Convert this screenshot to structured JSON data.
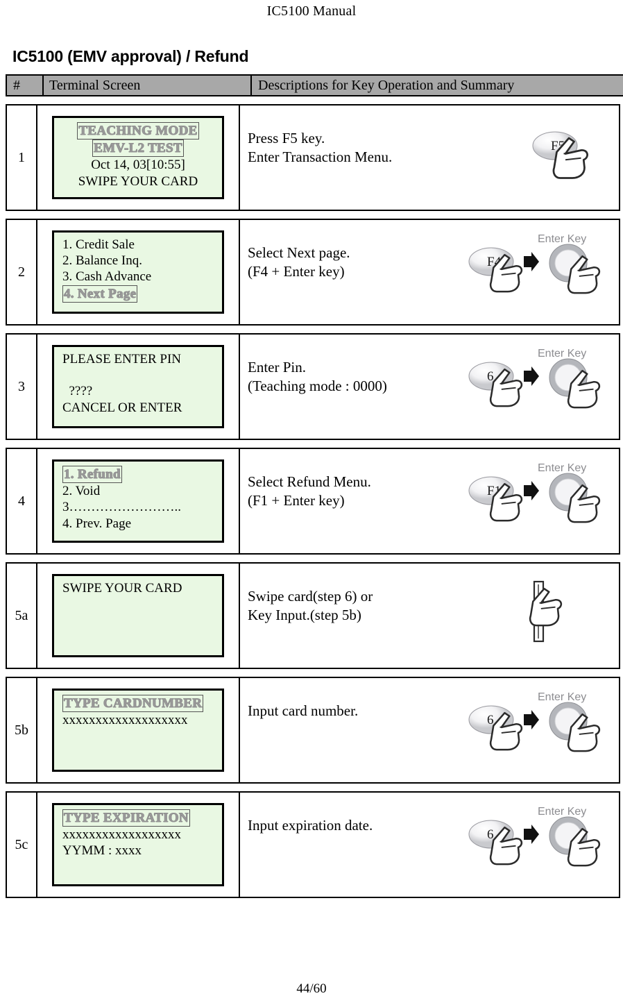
{
  "document": {
    "running_head": "IC5100 Manual",
    "section_title": "IC5100 (EMV approval) / Refund",
    "page_number": "44/60"
  },
  "table": {
    "headers": {
      "number": "#",
      "terminal_screen": "Terminal Screen",
      "description": "Descriptions for Key Operation and Summary"
    },
    "rows": [
      {
        "step": "1",
        "screen_lines": [
          {
            "text": "TEACHING MODE",
            "style": "outline",
            "align": "center"
          },
          {
            "text": "EMV-L2 TEST",
            "style": "outline",
            "align": "center"
          },
          {
            "text": "Oct 14, 03[10:55]",
            "style": "plain",
            "align": "center"
          },
          {
            "text": "SWIPE YOUR CARD",
            "style": "plain",
            "align": "center"
          }
        ],
        "description": "Press F5 key.\nEnter Transaction Menu.",
        "key_art": {
          "type": "single",
          "key_label": "F5",
          "enter_label": ""
        }
      },
      {
        "step": "2",
        "screen_lines": [
          {
            "text": "1. Credit Sale",
            "style": "plain",
            "align": "left"
          },
          {
            "text": "2. Balance Inq.",
            "style": "plain",
            "align": "left"
          },
          {
            "text": "3. Cash Advance",
            "style": "plain",
            "align": "left"
          },
          {
            "text": "4. Next Page",
            "style": "outline",
            "align": "left"
          }
        ],
        "description": "Select Next page.\n(F4 + Enter key)",
        "key_art": {
          "type": "combo",
          "key_label": "F4",
          "enter_label": "Enter Key"
        }
      },
      {
        "step": "3",
        "screen_lines": [
          {
            "text": "PLEASE ENTER PIN",
            "style": "plain",
            "align": "left"
          },
          {
            "text": " ",
            "style": "blank",
            "align": "left"
          },
          {
            "text": "  ????",
            "style": "plain",
            "align": "left"
          },
          {
            "text": "CANCEL OR ENTER",
            "style": "plain",
            "align": "left"
          }
        ],
        "description": "Enter Pin.\n(Teaching mode : 0000)",
        "key_art": {
          "type": "combo",
          "key_label": "6",
          "enter_label": "Enter Key"
        }
      },
      {
        "step": "4",
        "screen_lines": [
          {
            "text": "1. Refund",
            "style": "outline",
            "align": "left"
          },
          {
            "text": "2. Void",
            "style": "plain",
            "align": "left"
          },
          {
            "text": "3……………………..",
            "style": "plain",
            "align": "left"
          },
          {
            "text": "4. Prev. Page",
            "style": "plain",
            "align": "left"
          }
        ],
        "description": "Select Refund Menu.\n(F1 + Enter key)",
        "key_art": {
          "type": "combo",
          "key_label": "F1",
          "enter_label": "Enter Key"
        }
      },
      {
        "step": "5a",
        "screen_lines": [
          {
            "text": "SWIPE YOUR CARD",
            "style": "plain",
            "align": "left"
          },
          {
            "text": " ",
            "style": "blank",
            "align": "left"
          },
          {
            "text": " ",
            "style": "blank",
            "align": "left"
          },
          {
            "text": " ",
            "style": "blank",
            "align": "left"
          }
        ],
        "description": "Swipe card(step 6) or\nKey Input.(step 5b)",
        "key_art": {
          "type": "swipe",
          "key_label": "",
          "enter_label": ""
        }
      },
      {
        "step": "5b",
        "screen_lines": [
          {
            "text": "TYPE CARDNUMBER",
            "style": "outline",
            "align": "left"
          },
          {
            "text": "xxxxxxxxxxxxxxxxxxx",
            "style": "plain",
            "align": "left"
          },
          {
            "text": " ",
            "style": "blank",
            "align": "left"
          },
          {
            "text": " ",
            "style": "blank",
            "align": "left"
          }
        ],
        "description": "Input card number.",
        "key_art": {
          "type": "combo",
          "key_label": "6",
          "enter_label": "Enter Key"
        }
      },
      {
        "step": "5c",
        "screen_lines": [
          {
            "text": "TYPE EXPIRATION",
            "style": "outline",
            "align": "left"
          },
          {
            "text": "xxxxxxxxxxxxxxxxxx",
            "style": "plain",
            "align": "left"
          },
          {
            "text": "YYMM : xxxx",
            "style": "plain",
            "align": "left"
          },
          {
            "text": " ",
            "style": "blank",
            "align": "left"
          }
        ],
        "description": "Input expiration date.",
        "key_art": {
          "type": "combo",
          "key_label": "6",
          "enter_label": "Enter Key"
        }
      }
    ]
  },
  "colors": {
    "lcd_background": "#e9f8e3",
    "header_background": "#a8a8a8",
    "border": "#000000"
  }
}
